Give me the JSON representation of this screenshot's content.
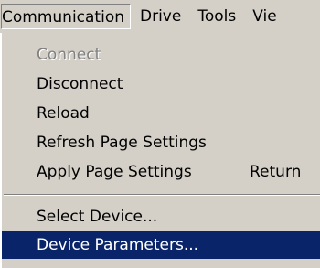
{
  "menubar": {
    "items": [
      {
        "label": "Communication"
      },
      {
        "label": "Drive"
      },
      {
        "label": "Tools"
      },
      {
        "label": "Vie"
      }
    ]
  },
  "dropdown": {
    "items": [
      {
        "label": "Connect",
        "state": "disabled"
      },
      {
        "label": "Disconnect"
      },
      {
        "label": "Reload"
      },
      {
        "label": "Refresh Page Settings"
      },
      {
        "label": "Apply Page Settings",
        "shortcut": "Return"
      },
      {
        "label": "Select Device..."
      },
      {
        "label": "Device Parameters...",
        "state": "highlighted"
      }
    ]
  },
  "colors": {
    "menu_background": "#d4d0c8",
    "highlight_background": "#0a246a",
    "highlight_text": "#ffffff",
    "disabled_text": "#808080"
  }
}
